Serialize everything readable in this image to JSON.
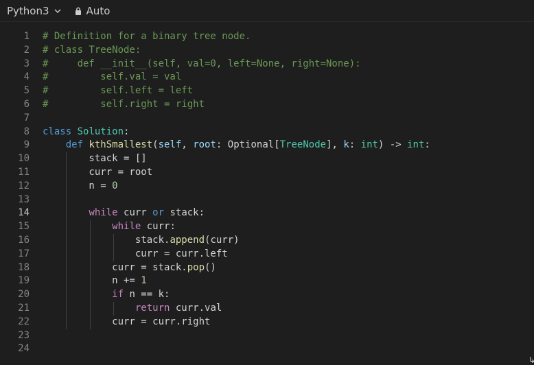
{
  "toolbar": {
    "language": "Python3",
    "mode": "Auto"
  },
  "editor": {
    "active_line": 14,
    "lines": [
      {
        "n": "1",
        "tokens": [
          {
            "t": "# Definition for a binary tree node.",
            "c": "c"
          }
        ]
      },
      {
        "n": "2",
        "tokens": [
          {
            "t": "# class TreeNode:",
            "c": "c"
          }
        ]
      },
      {
        "n": "3",
        "tokens": [
          {
            "t": "#     def __init__(self, val=0, left=None, right=None):",
            "c": "c"
          }
        ]
      },
      {
        "n": "4",
        "tokens": [
          {
            "t": "#         self.val = val",
            "c": "c"
          }
        ]
      },
      {
        "n": "5",
        "tokens": [
          {
            "t": "#         self.left = left",
            "c": "c"
          }
        ]
      },
      {
        "n": "6",
        "tokens": [
          {
            "t": "#         self.right = right",
            "c": "c"
          }
        ]
      },
      {
        "n": "7",
        "tokens": []
      },
      {
        "n": "8",
        "tokens": [
          {
            "t": "class",
            "c": "k"
          },
          {
            "t": " "
          },
          {
            "t": "Solution",
            "c": "cls"
          },
          {
            "t": ":"
          }
        ]
      },
      {
        "n": "9",
        "tokens": [
          {
            "t": "    "
          },
          {
            "t": "def",
            "c": "k"
          },
          {
            "t": " "
          },
          {
            "t": "kthSmallest",
            "c": "fn"
          },
          {
            "t": "("
          },
          {
            "t": "self",
            "c": "pa"
          },
          {
            "t": ", "
          },
          {
            "t": "root",
            "c": "pa"
          },
          {
            "t": ": Optional["
          },
          {
            "t": "TreeNode",
            "c": "cls"
          },
          {
            "t": "], "
          },
          {
            "t": "k",
            "c": "pa"
          },
          {
            "t": ": "
          },
          {
            "t": "int",
            "c": "cls"
          },
          {
            "t": ") -> "
          },
          {
            "t": "int",
            "c": "cls"
          },
          {
            "t": ":"
          }
        ]
      },
      {
        "n": "10",
        "tokens": [
          {
            "t": "        stack = []"
          }
        ]
      },
      {
        "n": "11",
        "tokens": [
          {
            "t": "        curr = root"
          }
        ]
      },
      {
        "n": "12",
        "tokens": [
          {
            "t": "        n = "
          },
          {
            "t": "0",
            "c": "num"
          }
        ]
      },
      {
        "n": "13",
        "tokens": []
      },
      {
        "n": "14",
        "tokens": [
          {
            "t": "        "
          },
          {
            "t": "while",
            "c": "kc"
          },
          {
            "t": " curr "
          },
          {
            "t": "or",
            "c": "k"
          },
          {
            "t": " stack:"
          }
        ]
      },
      {
        "n": "15",
        "tokens": [
          {
            "t": "            "
          },
          {
            "t": "while",
            "c": "kc"
          },
          {
            "t": " curr:"
          }
        ]
      },
      {
        "n": "16",
        "tokens": [
          {
            "t": "                stack."
          },
          {
            "t": "append",
            "c": "fn"
          },
          {
            "t": "(curr)"
          }
        ]
      },
      {
        "n": "17",
        "tokens": [
          {
            "t": "                curr = curr.left"
          }
        ]
      },
      {
        "n": "18",
        "tokens": [
          {
            "t": "            curr = stack."
          },
          {
            "t": "pop",
            "c": "fn"
          },
          {
            "t": "()"
          }
        ]
      },
      {
        "n": "19",
        "tokens": [
          {
            "t": "            n += "
          },
          {
            "t": "1",
            "c": "num"
          }
        ]
      },
      {
        "n": "20",
        "tokens": [
          {
            "t": "            "
          },
          {
            "t": "if",
            "c": "kc"
          },
          {
            "t": " n == k:"
          }
        ]
      },
      {
        "n": "21",
        "tokens": [
          {
            "t": "                "
          },
          {
            "t": "return",
            "c": "kc"
          },
          {
            "t": " curr.val"
          }
        ]
      },
      {
        "n": "22",
        "tokens": [
          {
            "t": "            curr = curr.right"
          }
        ]
      },
      {
        "n": "23",
        "tokens": []
      },
      {
        "n": "24",
        "tokens": []
      }
    ]
  }
}
